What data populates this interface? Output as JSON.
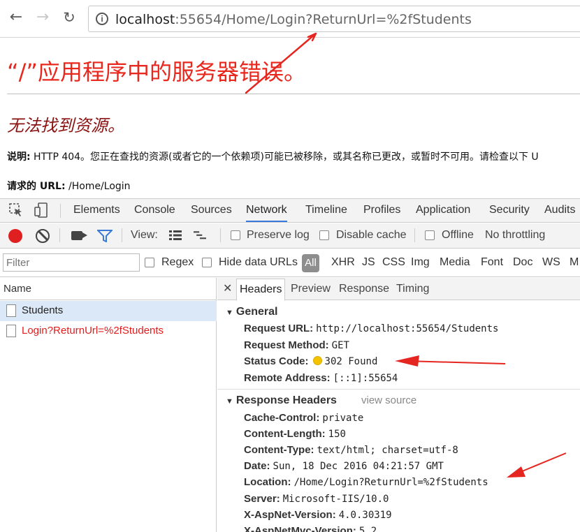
{
  "browser": {
    "url_host": "localhost",
    "url_rest": ":55654/Home/Login?ReturnUrl=%2fStudents"
  },
  "page": {
    "title": "“/”应用程序中的服务器错误。",
    "subtitle": "无法找到资源。",
    "desc_label": "说明:",
    "desc_text": " HTTP 404。您正在查找的资源(或者它的一个依赖项)可能已被移除，或其名称已更改，或暂时不可用。请检查以下 U",
    "req_label": "请求的 URL:",
    "req_value": " /Home/Login"
  },
  "devtools": {
    "tabs": [
      "Elements",
      "Console",
      "Sources",
      "Network",
      "Timeline",
      "Profiles",
      "Application",
      "Security",
      "Audits"
    ],
    "toolbar": {
      "view_label": "View:",
      "preserve_log": "Preserve log",
      "disable_cache": "Disable cache",
      "offline": "Offline",
      "throttling": "No throttling"
    },
    "filter": {
      "placeholder": "Filter",
      "regex": "Regex",
      "hide_data_urls": "Hide data URLs",
      "types": [
        "All",
        "XHR",
        "JS",
        "CSS",
        "Img",
        "Media",
        "Font",
        "Doc",
        "WS",
        "M"
      ]
    },
    "requests": {
      "header": "Name",
      "items": [
        "Students",
        "Login?ReturnUrl=%2fStudents"
      ]
    },
    "detail": {
      "tabs": [
        "Headers",
        "Preview",
        "Response",
        "Timing"
      ],
      "general_title": "General",
      "general": [
        {
          "k": "Request URL:",
          "v": "http://localhost:55654/Students"
        },
        {
          "k": "Request Method:",
          "v": "GET"
        },
        {
          "k": "Status Code:",
          "v": "302 Found"
        },
        {
          "k": "Remote Address:",
          "v": "[::1]:55654"
        }
      ],
      "response_title": "Response Headers",
      "view_source": "view source",
      "response": [
        {
          "k": "Cache-Control:",
          "v": "private"
        },
        {
          "k": "Content-Length:",
          "v": "150"
        },
        {
          "k": "Content-Type:",
          "v": "text/html; charset=utf-8"
        },
        {
          "k": "Date:",
          "v": "Sun, 18 Dec 2016 04:21:57 GMT"
        },
        {
          "k": "Location:",
          "v": "/Home/Login?ReturnUrl=%2fStudents"
        },
        {
          "k": "Server:",
          "v": "Microsoft-IIS/10.0"
        },
        {
          "k": "X-AspNet-Version:",
          "v": "4.0.30319"
        },
        {
          "k": "X-AspNetMvc-Version:",
          "v": "5.2"
        }
      ]
    }
  },
  "colors": {
    "accent_blue": "#3879d9",
    "error_red": "#e8271d",
    "annotation_red": "#e52520"
  }
}
